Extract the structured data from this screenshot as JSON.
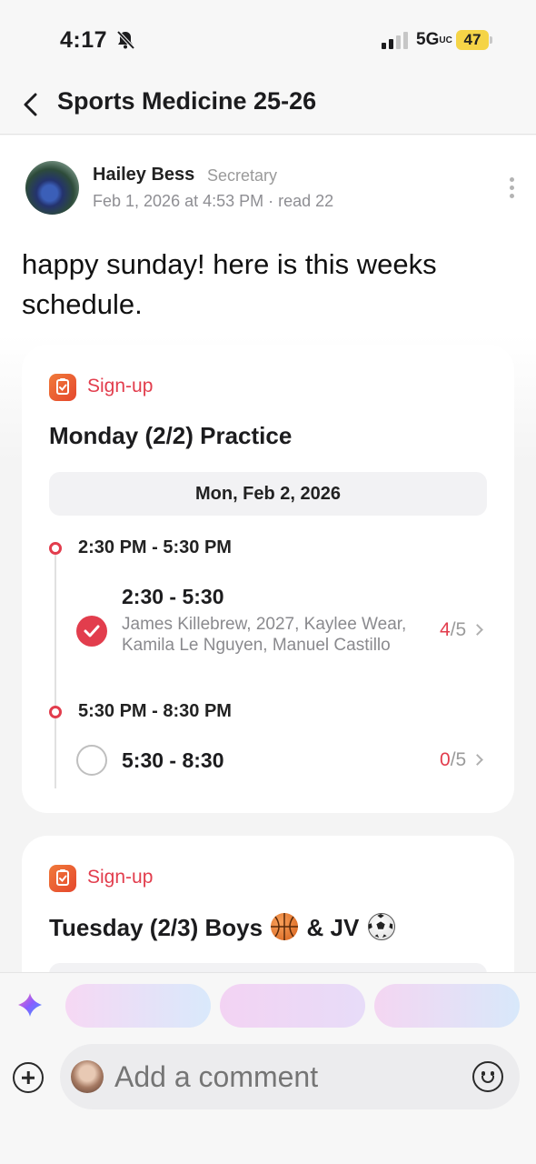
{
  "status_bar": {
    "time": "4:17",
    "network": "5G",
    "network_suffix": "UC",
    "battery": "47"
  },
  "nav": {
    "title": "Sports Medicine 25-26"
  },
  "post": {
    "author_name": "Hailey Bess",
    "author_role": "Secretary",
    "meta": "Feb 1, 2026 at 4:53 PM · read 22",
    "text": "happy sunday! here is this weeks schedule."
  },
  "cards": [
    {
      "tag": "Sign-up",
      "title": "Monday (2/2) Practice",
      "date": "Mon, Feb 2, 2026",
      "slots": [
        {
          "time": "2:30 PM - 5:30 PM",
          "shift_title": "2:30 - 5:30",
          "names": "James Killebrew, 2027, Kaylee Wear, Kamila Le Nguyen, Manuel Castillo",
          "filled": "4",
          "capacity": "/5",
          "checked": true
        },
        {
          "time": "5:30 PM - 8:30 PM",
          "shift_title": "5:30 - 8:30",
          "names": "",
          "filled": "0",
          "capacity": "/5",
          "checked": false
        }
      ]
    },
    {
      "tag": "Sign-up",
      "title_part1": "Tuesday (2/3) Boys",
      "title_part2": "& JV",
      "title_icons": [
        "basketball-emoji",
        "soccer-ball-emoji"
      ]
    }
  ],
  "composer": {
    "placeholder": "Add a comment"
  },
  "colors": {
    "accent": "#e23d4d",
    "tag_icon": "#ec5a33"
  }
}
